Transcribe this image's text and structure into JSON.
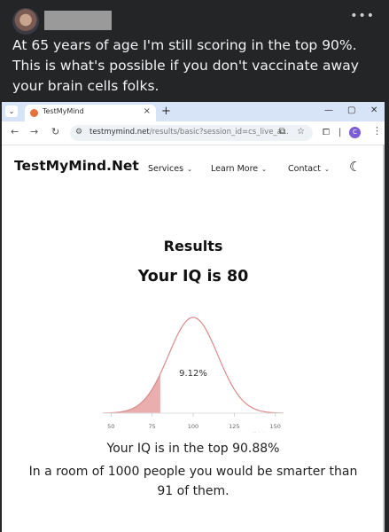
{
  "post": {
    "text": "At 65 years of age I'm still scoring in the top 90%. This is what's possible if you don't vaccinate away your brain cells folks.",
    "more_icon": "more-horizontal-icon"
  },
  "browser": {
    "tab_title": "TestMyMind",
    "tab_close": "×",
    "new_tab": "+",
    "url_host": "testmymind.net",
    "url_path": "/results/basic?session_id=cs_live_a...",
    "profile_initial": "C",
    "icons": [
      "chevron-down-icon",
      "back-icon",
      "forward-icon",
      "reload-icon",
      "site-settings-icon",
      "cast-icon",
      "star-icon",
      "extensions-icon",
      "profile-icon",
      "menu-icon",
      "minimize-icon",
      "maximize-icon",
      "close-icon"
    ]
  },
  "site": {
    "brand": "TestMyMind.Net",
    "nav": [
      {
        "label": "Services"
      },
      {
        "label": "Learn More"
      },
      {
        "label": "Contact"
      }
    ],
    "theme_icon": "moon-icon"
  },
  "results": {
    "heading": "Results",
    "iq_line": "Your IQ is 80",
    "top_line": "Your IQ is in the top 90.88%",
    "room_line_1": "In a room of 1000 people you would be smarter than",
    "room_line_2": "91 of them."
  },
  "chart_data": {
    "type": "area",
    "x_ticks": [
      50,
      75,
      100,
      125,
      150
    ],
    "xlim": [
      45,
      155
    ],
    "mean": 100,
    "sd": 15,
    "shaded_upto": 80,
    "shaded_label": "9.12%",
    "credit": "Highcharts.com",
    "colors": {
      "line": "#d98a8a",
      "shade": "#e8a0a0",
      "grid": "#dddddd"
    }
  }
}
